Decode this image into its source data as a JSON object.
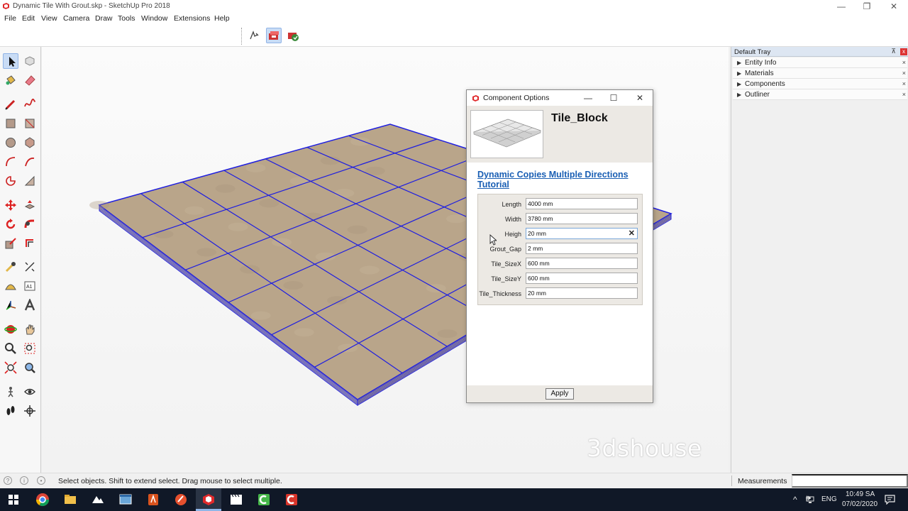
{
  "window": {
    "title": "Dynamic Tile With Grout.skp - SketchUp Pro 2018",
    "minimize": "—",
    "maximize": "❐",
    "close": "✕"
  },
  "menu": [
    "File",
    "Edit",
    "View",
    "Camera",
    "Draw",
    "Tools",
    "Window",
    "Extensions",
    "Help"
  ],
  "toolbar": {
    "buttons": [
      "interact-icon",
      "component-options-icon",
      "component-attributes-icon"
    ]
  },
  "dialog": {
    "title": "Component Options",
    "component_name": "Tile_Block",
    "tutorial_link": "Dynamic Copies Multiple Directions Tutorial",
    "attributes": [
      {
        "label": "Length",
        "value": "4000 mm"
      },
      {
        "label": "Width",
        "value": "3780 mm"
      },
      {
        "label": "Heigh",
        "value": "20 mm"
      },
      {
        "label": "Grout_Gap",
        "value": "2 mm"
      },
      {
        "label": "Tile_SizeX",
        "value": "600 mm"
      },
      {
        "label": "Tile_SizeY",
        "value": "600 mm"
      },
      {
        "label": "Tile_Thickness",
        "value": "20 mm"
      }
    ],
    "clear_icon": "✕",
    "apply_label": "Apply"
  },
  "tray": {
    "title": "Default Tray",
    "pin": "📌",
    "close": "x",
    "panels": [
      "Entity Info",
      "Materials",
      "Components",
      "Outliner"
    ]
  },
  "status": {
    "text": "Select objects. Shift to extend select. Drag mouse to select multiple.",
    "measurements_label": "Measurements"
  },
  "watermark": "3dshouse",
  "taskbar": {
    "icons": [
      "windows-start-icon",
      "chrome-icon",
      "file-explorer-icon",
      "photos-icon",
      "window-app-icon",
      "app-orange-icon",
      "app-red-icon",
      "sketchup-icon",
      "video-editor-icon",
      "camtasia-icon",
      "app-red2-icon"
    ],
    "lang": "ENG",
    "time": "10:49 SA",
    "date": "07/02/2020"
  },
  "colors": {
    "selection_edge": "#1f1fe0",
    "tile_color": "#b9a58a",
    "link_color": "#1a5fb4",
    "taskbar": "#101827"
  }
}
